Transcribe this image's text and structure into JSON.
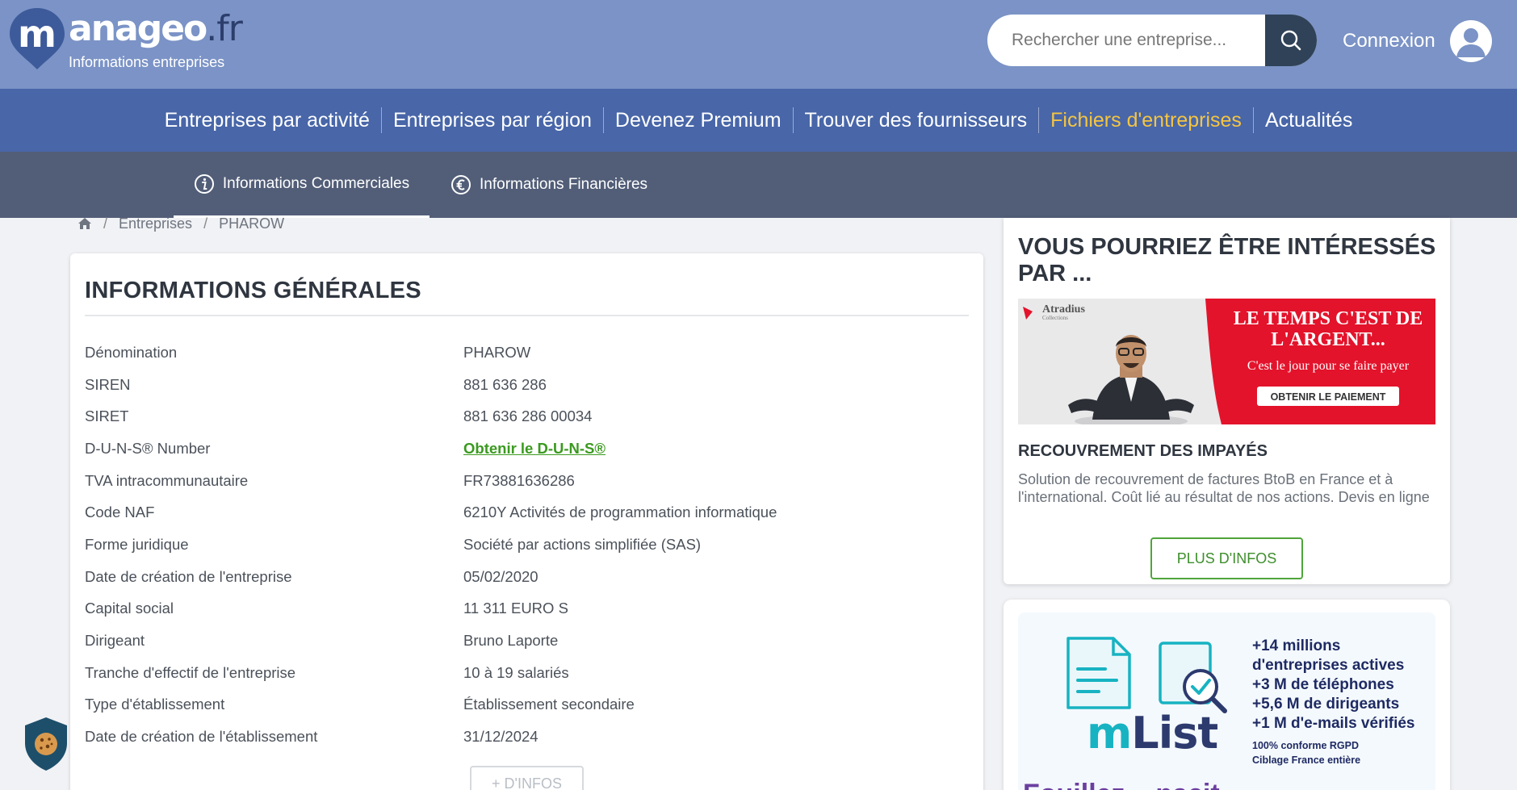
{
  "brand": {
    "logo_main": "anageo",
    "logo_tld": ".fr",
    "tagline": "Informations entreprises"
  },
  "search": {
    "placeholder": "Rechercher une entreprise..."
  },
  "login": {
    "label": "Connexion"
  },
  "main_nav": {
    "items": [
      {
        "label": "Entreprises par activité"
      },
      {
        "label": "Entreprises par région"
      },
      {
        "label": "Devenez Premium"
      },
      {
        "label": "Trouver des fournisseurs"
      },
      {
        "label": "Fichiers d'entreprises"
      },
      {
        "label": "Actualités"
      }
    ],
    "active_color": "#f5c542"
  },
  "sub_nav": {
    "tabs": [
      {
        "label": "Informations Commerciales",
        "icon": "info-circle-icon",
        "active": true
      },
      {
        "label": "Informations Financières",
        "icon": "euro-circle-icon",
        "active": false
      }
    ]
  },
  "breadcrumb": {
    "items": [
      "Entreprises",
      "PHAROW"
    ]
  },
  "general_info": {
    "title": "INFORMATIONS GÉNÉRALES",
    "rows": [
      {
        "label": "Dénomination",
        "value": "PHAROW"
      },
      {
        "label": "SIREN",
        "value": "881 636 286"
      },
      {
        "label": "SIRET",
        "value": "881 636 286 00034"
      },
      {
        "label": "D-U-N-S® Number",
        "value": "Obtenir le D-U-N-S®"
      },
      {
        "label": "TVA intracommunautaire",
        "value": "FR73881636286"
      },
      {
        "label": "Code NAF",
        "value": "6210Y Activités de programmation informatique"
      },
      {
        "label": "Forme juridique",
        "value": "Société par actions simplifiée (SAS)"
      },
      {
        "label": "Date de création de l'entreprise",
        "value": "05/02/2020"
      },
      {
        "label": "Capital social",
        "value": "11 311 EURO S"
      },
      {
        "label": "Dirigeant",
        "value": "Bruno Laporte"
      },
      {
        "label": "Tranche d'effectif de l'entreprise",
        "value": "10 à 19 salariés"
      },
      {
        "label": "Type d'établissement",
        "value": "Établissement secondaire"
      },
      {
        "label": "Date de création de l'établissement",
        "value": "31/12/2024"
      }
    ],
    "more_button": "+ D'INFOS"
  },
  "sidebar_ad": {
    "title": "VOUS POURRIEZ ÊTRE INTÉRESSÉS PAR ...",
    "banner": {
      "brand": "Atradius",
      "brand_sub": "Collections",
      "headline_1": "LE TEMPS C'EST DE",
      "headline_2": "L'ARGENT...",
      "tagline": "C'est le jour pour se faire payer",
      "cta": "OBTENIR LE PAIEMENT",
      "accent": "#e3132b"
    },
    "subtitle": "RECOUVREMENT DES IMPAYÉS",
    "description": "Solution de recouvrement de factures BtoB en France et à l'international. Coût lié au résultat de nos actions. Devis en ligne",
    "button": "PLUS D'INFOS"
  },
  "mlist_ad": {
    "word_m": "m",
    "word_list": "List",
    "stats": [
      "+14 millions",
      "d'entreprises actives",
      "+3 M de téléphones",
      "+5,6 M de dirigeants",
      "+1 M d'e-mails vérifiés"
    ],
    "small": [
      "100% conforme RGPD",
      "Ciblage France entière"
    ],
    "bottom_text": "Fouillez ...nacit..."
  },
  "colors": {
    "header": "#7b93c6",
    "main_nav": "#4866a8",
    "sub_nav": "#525e78",
    "link_green": "#3a9a1f"
  }
}
